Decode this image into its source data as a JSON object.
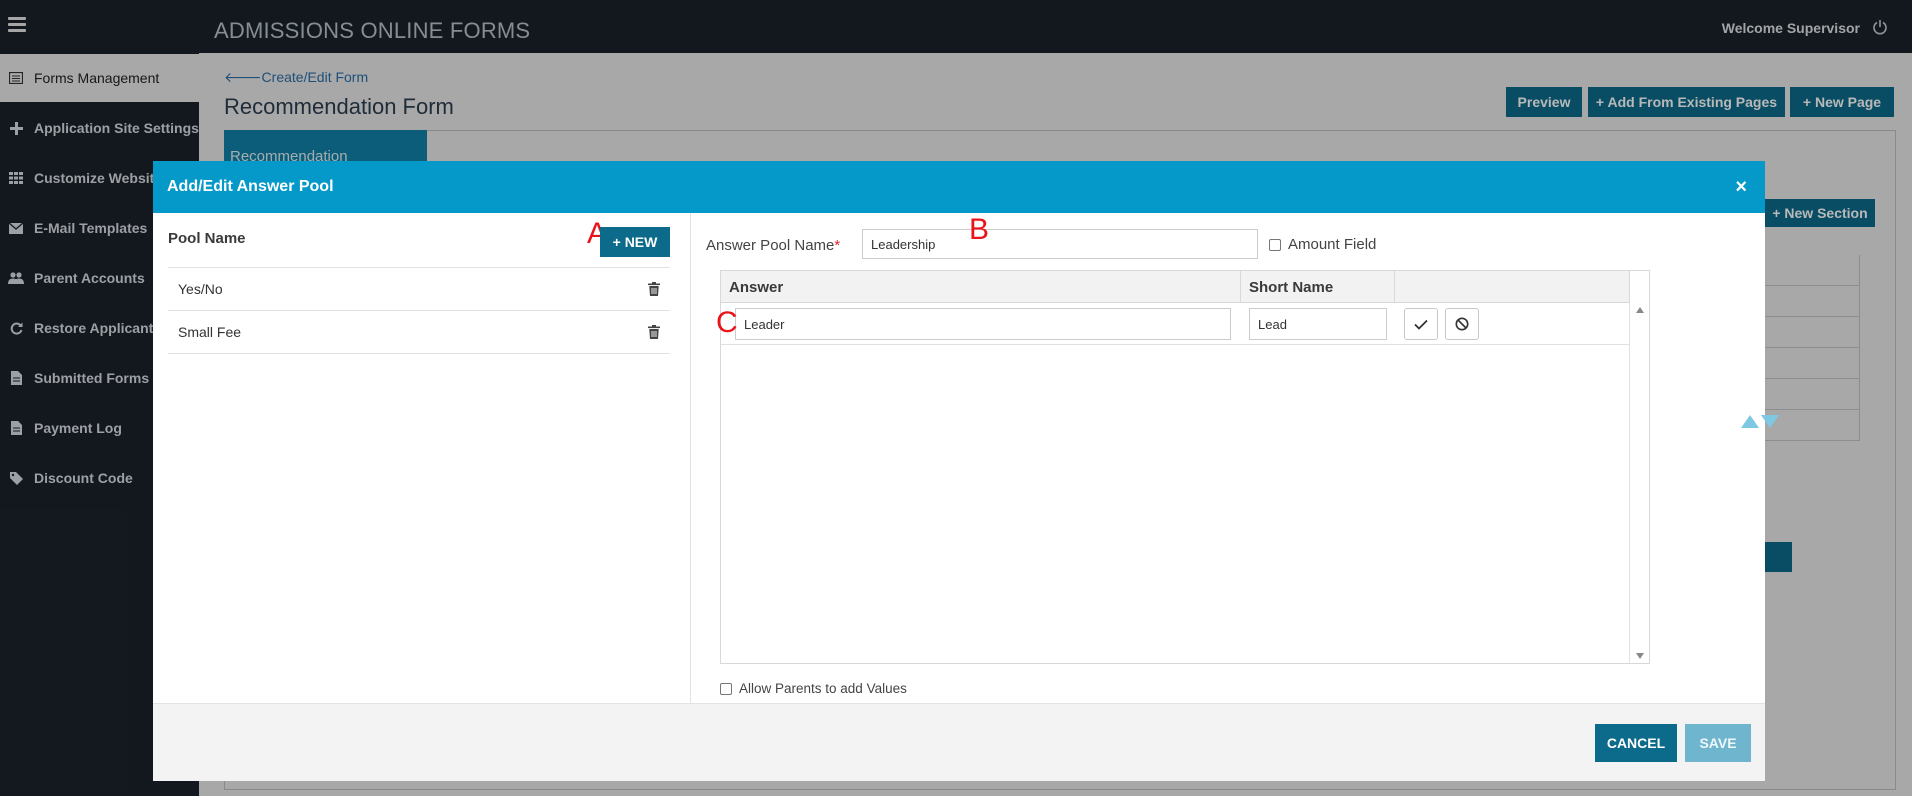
{
  "header": {
    "app_title": "ADMISSIONS ONLINE FORMS",
    "welcome_text": "Welcome Supervisor",
    "menu_icon": "hamburger-icon",
    "power_icon": "power-icon"
  },
  "sidebar": {
    "items": [
      {
        "label": "Forms Management",
        "icon": "form-icon",
        "active": true
      },
      {
        "label": "Application Site Settings",
        "icon": "plus-icon"
      },
      {
        "label": "Customize Website",
        "icon": "grid-icon"
      },
      {
        "label": "E-Mail Templates",
        "icon": "envelope-icon"
      },
      {
        "label": "Parent Accounts",
        "icon": "users-icon"
      },
      {
        "label": "Restore Applicant F",
        "icon": "refresh-icon"
      },
      {
        "label": "Submitted Forms lo",
        "icon": "document-icon"
      },
      {
        "label": "Payment Log",
        "icon": "document-icon"
      },
      {
        "label": "Discount Code",
        "icon": "tag-icon"
      }
    ]
  },
  "page": {
    "back_link": "Create/Edit Form",
    "title": "Recommendation Form",
    "preview_label": "Preview",
    "add_existing_label": "+ Add From Existing Pages",
    "new_page_label": "+ New Page",
    "tab_label": "Recommendation",
    "new_section_label": "+ New Section"
  },
  "modal": {
    "title": "Add/Edit Answer Pool",
    "close_symbol": "×",
    "pool_name_label": "Pool Name",
    "new_button": "+ NEW",
    "pools": [
      {
        "name": "Yes/No"
      },
      {
        "name": "Small Fee"
      }
    ],
    "answer_pool_name_label": "Answer Pool Name",
    "required_mark": "*",
    "answer_pool_name_value": "Leadership",
    "amount_field_label": "Amount Field",
    "columns": {
      "answer": "Answer",
      "short_name": "Short Name"
    },
    "rows": [
      {
        "answer": "Leader",
        "short_name": "Lead"
      }
    ],
    "allow_parents_label": "Allow Parents to add Values",
    "cancel_label": "CANCEL",
    "save_label": "SAVE"
  },
  "annotations": {
    "a": "A",
    "b": "B",
    "c": "C"
  },
  "colors": {
    "header_bg": "#1b222b",
    "modal_header": "#0499c9",
    "primary_button": "#0c6b8a",
    "save_disabled": "#6fb5ce",
    "annotation_red": "#e8141a"
  }
}
